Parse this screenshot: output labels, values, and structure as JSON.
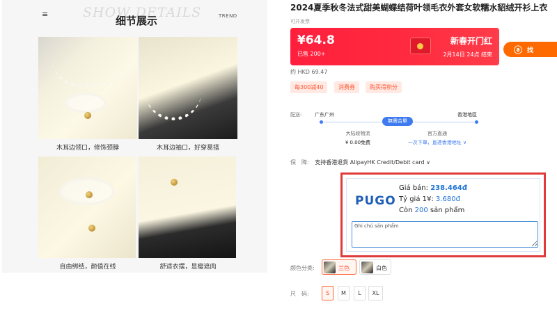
{
  "detail": {
    "menu_icon": "≡",
    "watermark": "SHOW DETAILS",
    "title": "细节展示",
    "trend": "TREND",
    "captions": [
      "木耳边领口，修饰颈脖",
      "木耳边袖口，好穿易搭",
      "自由绑结，颜值在线",
      "舒适衣摆，显瘦遮肉"
    ]
  },
  "product": {
    "title": "2024夏季秋冬法式甜美蝴蝶结荷叶领毛衣外套女软糯水貂绒开衫上衣",
    "invoice_note": "可开发票",
    "price": "¥64.8",
    "sold": "已售 200+",
    "promo_title": "新春开门红",
    "promo_date": "2月14日 24点 结束",
    "taobao_label": "找",
    "hkd_price": "约 HKD 69.47",
    "coupons": [
      "每300减40",
      "消费券",
      "购买得积分"
    ]
  },
  "shipping": {
    "label": "配送:",
    "from": "广东广州",
    "to": "香港地區",
    "pill": "無需合單",
    "left_title": "大陆段物流",
    "left_value": "¥ 0.00免费",
    "right_title": "官方直通",
    "right_value": "一次下單，直達香港地址 ∨"
  },
  "guarantee": {
    "label": "保　障:",
    "text": "支持香港退貨 AlipayHK Credit/Debit card ∨"
  },
  "pugo": {
    "logo": "PUGO",
    "price_label": "Giá bán:",
    "price_value": "238.464đ",
    "rate_label": "Tỷ giá 1¥:",
    "rate_value": "3.680đ",
    "stock_prefix": "Còn",
    "stock_value": "200",
    "stock_suffix": "sản phẩm",
    "note_placeholder": "Ghi chú sản phẩm"
  },
  "options": {
    "color_label": "颜色分类:",
    "colors": [
      {
        "name": "兰色",
        "selected": true
      },
      {
        "name": "白色",
        "selected": false
      }
    ],
    "size_label": "尺　码:",
    "sizes": [
      "S",
      "M",
      "L",
      "XL"
    ],
    "selected_size": "S"
  },
  "colors": {
    "price_banner": "#ff1f3d",
    "taobao_orange": "#ff6a00",
    "highlight_border": "#e03a3a",
    "pugo_blue": "#1e5eb8"
  }
}
